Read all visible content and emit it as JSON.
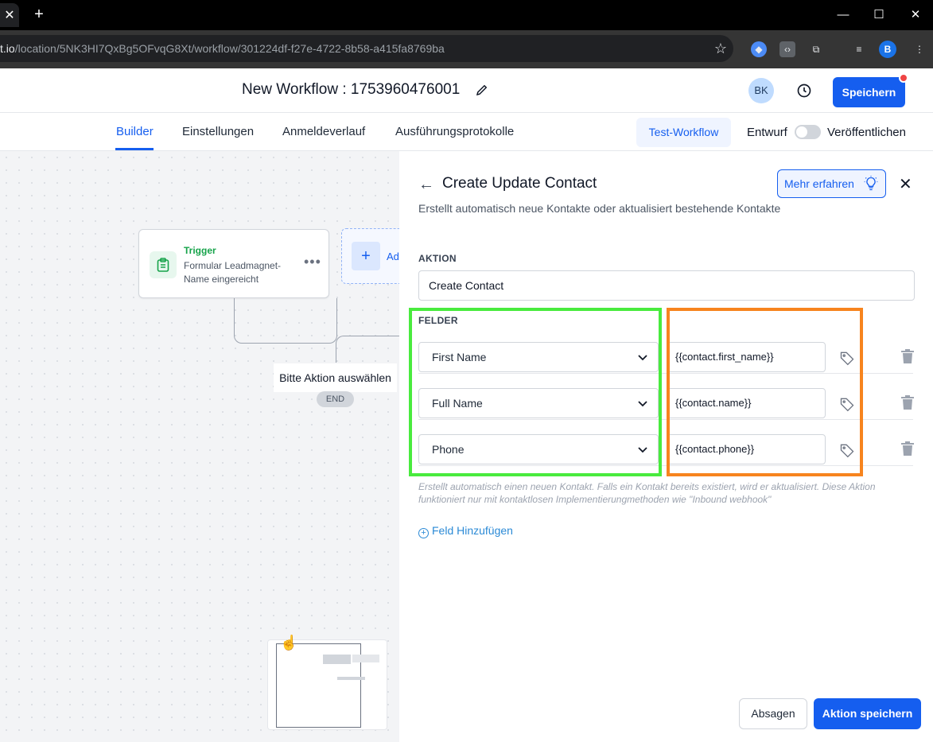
{
  "browser": {
    "url_host": "t.io",
    "url_path": "/location/5NK3HI7QxBg5OFvqG8Xt/workflow/301224df-f27e-4722-8b58-a415fa8769ba",
    "profile_initial": "B"
  },
  "header": {
    "title": "New Workflow : 1753960476001",
    "avatar_initials": "BK",
    "save_label": "Speichern"
  },
  "tabs": [
    "Builder",
    "Einstellungen",
    "Anmeldeverlauf",
    "Ausführungsprotokolle"
  ],
  "toolbar": {
    "test_label": "Test-Workflow",
    "draft_label": "Entwurf",
    "publish_label": "Veröffentlichen"
  },
  "canvas": {
    "trigger_label": "Trigger",
    "trigger_desc": "Formular Leadmagnet-Name eingereicht",
    "add_label": "Ad",
    "select_action": "Bitte Aktion auswählen",
    "end_label": "END"
  },
  "panel": {
    "title": "Create Update Contact",
    "subtitle": "Erstellt automatisch neue Kontakte oder aktualisiert bestehende Kontakte",
    "learn_more": "Mehr erfahren",
    "action_label": "AKTION",
    "action_value": "Create Contact",
    "fields_label": "FELDER",
    "fields": [
      {
        "name": "First Name",
        "value": "{{contact.first_name}}"
      },
      {
        "name": "Full Name",
        "value": "{{contact.name}}"
      },
      {
        "name": "Phone",
        "value": "{{contact.phone}}"
      }
    ],
    "hint": "Erstellt automatisch einen neuen Kontakt. Falls ein Kontakt bereits existiert, wird er aktualisiert. Diese Aktion funktioniert nur mit kontaktlosen Implementierungmethoden wie \"Inbound webhook\"",
    "add_field": "Feld Hinzufügen",
    "cancel": "Absagen",
    "confirm": "Aktion speichern"
  },
  "colors": {
    "primary": "#155eef",
    "highlight_green": "#49eb3e",
    "highlight_orange": "#f7841e"
  }
}
